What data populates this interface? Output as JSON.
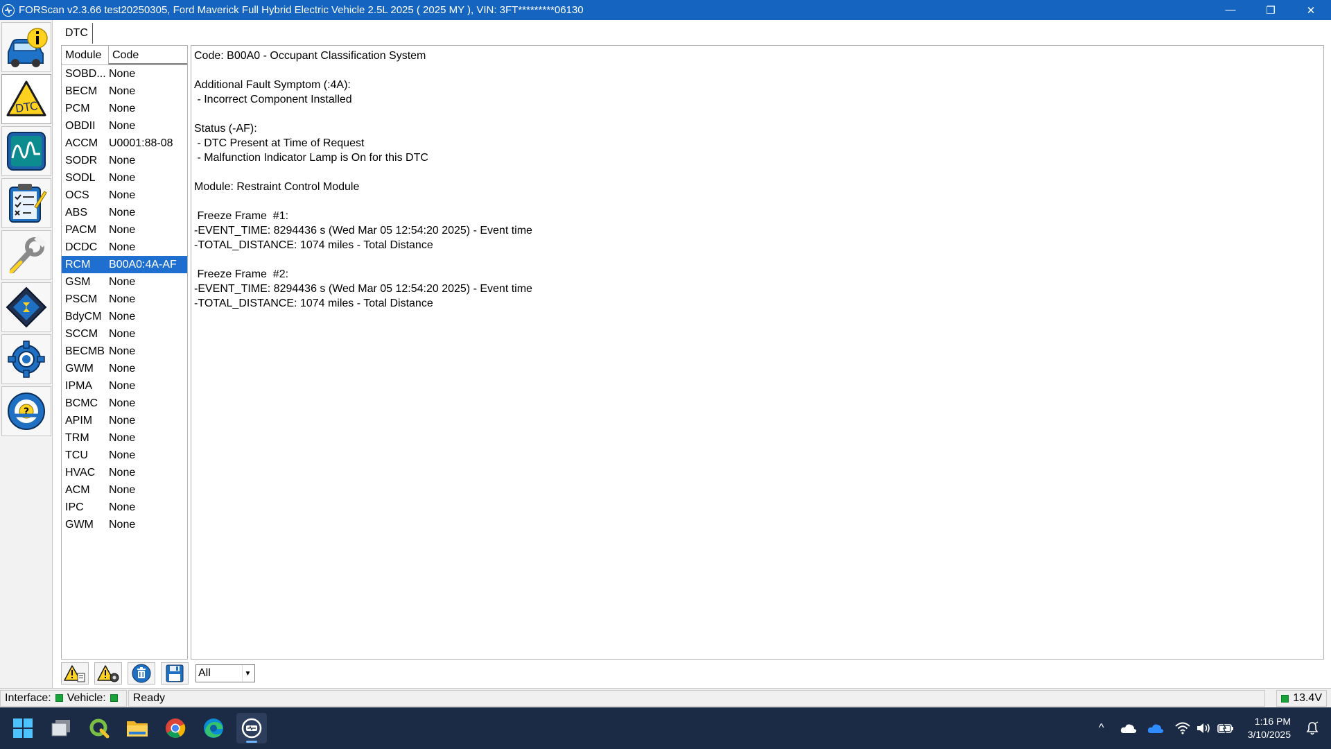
{
  "window": {
    "title": "FORScan v2.3.66 test20250305, Ford Maverick Full Hybrid Electric Vehicle 2.5L 2025 ( 2025 MY ), VIN: 3FT*********06130",
    "minimize_glyph": "—",
    "restore_glyph": "❐",
    "close_glyph": "✕"
  },
  "left_toolbar": {
    "buttons": [
      {
        "name": "vehicle-info-icon",
        "active": false
      },
      {
        "name": "dtc-icon",
        "label": "DTC",
        "active": true
      },
      {
        "name": "oscilloscope-icon",
        "active": false
      },
      {
        "name": "checklist-icon",
        "active": false
      },
      {
        "name": "wrench-icon",
        "active": false
      },
      {
        "name": "chip-icon",
        "active": false
      },
      {
        "name": "gear-icon",
        "active": false
      },
      {
        "name": "help-icon",
        "label": "?",
        "active": false
      }
    ]
  },
  "tabs": [
    {
      "label": "DTC"
    }
  ],
  "dtc_table": {
    "columns": [
      "Module",
      "Code"
    ],
    "rows": [
      {
        "module": "SOBD...",
        "code": "None"
      },
      {
        "module": "BECM",
        "code": "None"
      },
      {
        "module": "PCM",
        "code": "None"
      },
      {
        "module": "OBDII",
        "code": "None"
      },
      {
        "module": "ACCM",
        "code": "U0001:88-08"
      },
      {
        "module": "SODR",
        "code": "None"
      },
      {
        "module": "SODL",
        "code": "None"
      },
      {
        "module": "OCS",
        "code": "None"
      },
      {
        "module": "ABS",
        "code": "None"
      },
      {
        "module": "PACM",
        "code": "None"
      },
      {
        "module": "DCDC",
        "code": "None"
      },
      {
        "module": "RCM",
        "code": "B00A0:4A-AF",
        "selected": true
      },
      {
        "module": "GSM",
        "code": "None"
      },
      {
        "module": "PSCM",
        "code": "None"
      },
      {
        "module": "BdyCM",
        "code": "None"
      },
      {
        "module": "SCCM",
        "code": "None"
      },
      {
        "module": "BECMB",
        "code": "None"
      },
      {
        "module": "GWM",
        "code": "None"
      },
      {
        "module": "IPMA",
        "code": "None"
      },
      {
        "module": "BCMC",
        "code": "None"
      },
      {
        "module": "APIM",
        "code": "None"
      },
      {
        "module": "TRM",
        "code": "None"
      },
      {
        "module": "TCU",
        "code": "None"
      },
      {
        "module": "HVAC",
        "code": "None"
      },
      {
        "module": "ACM",
        "code": "None"
      },
      {
        "module": "IPC",
        "code": "None"
      },
      {
        "module": "GWM",
        "code": "None"
      }
    ]
  },
  "detail": {
    "lines": [
      "Code: B00A0 - Occupant Classification System",
      "",
      "Additional Fault Symptom (:4A):",
      " - Incorrect Component Installed",
      "",
      "Status (-AF):",
      " - DTC Present at Time of Request",
      " - Malfunction Indicator Lamp is On for this DTC",
      "",
      "Module: Restraint Control Module",
      "",
      " Freeze Frame  #1:",
      "-EVENT_TIME: 8294436 s (Wed Mar 05 12:54:20 2025) - Event time",
      "-TOTAL_DISTANCE: 1074 miles - Total Distance",
      "",
      " Freeze Frame  #2:",
      "-EVENT_TIME: 8294436 s (Wed Mar 05 12:54:20 2025) - Event time",
      "-TOTAL_DISTANCE: 1074 miles - Total Distance"
    ]
  },
  "bottom_toolbar": {
    "filter_value": "All",
    "filter_arrow": "▼"
  },
  "statusbar": {
    "interface_label": "Interface:",
    "vehicle_label": "Vehicle:",
    "status": "Ready",
    "voltage": "13.4V",
    "led_color": "#19a33a"
  },
  "taskbar": {
    "apps": [
      "windows-start-icon",
      "task-view-icon",
      "qgis-icon",
      "file-explorer-icon",
      "chrome-icon",
      "edge-icon",
      "forscan-taskbar-icon"
    ],
    "tray_chevron": "^",
    "time": "1:16 PM",
    "date": "3/10/2025"
  },
  "colors": {
    "title_bar": "#1565c0",
    "selection": "#1e6fcf",
    "taskbar": "#1b2b45"
  }
}
